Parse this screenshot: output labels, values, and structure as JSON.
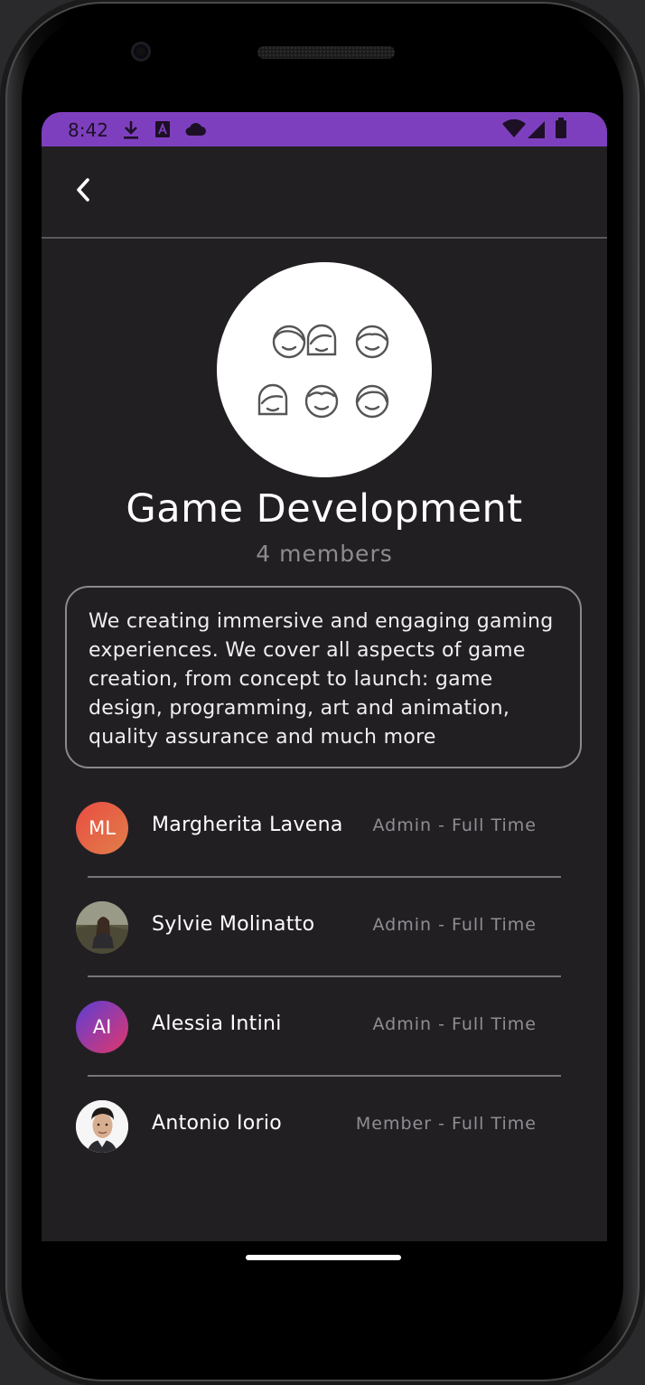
{
  "status_bar": {
    "time": "8:42",
    "left_icons": [
      "download-icon",
      "text-a-icon",
      "cloud-icon"
    ],
    "right_icons": [
      "wifi-icon",
      "signal-icon",
      "battery-icon"
    ],
    "color": "#7e3fbf"
  },
  "header": {
    "back_icon": "chevron-left-icon"
  },
  "group": {
    "avatar_icon": "people-group-icon",
    "title": "Game Development",
    "member_count": "4 members",
    "description": "We creating immersive and engaging gaming experiences. We cover all aspects of game creation, from concept to launch: game design, programming, art and animation, quality assurance and much more"
  },
  "members": [
    {
      "initials": "ML",
      "name": "Margherita Lavena",
      "role": "Admin - Full Time",
      "avatar_type": "initials",
      "avatar_colors": [
        "#e9503f",
        "#e07a4c"
      ]
    },
    {
      "initials": "",
      "name": "Sylvie Molinatto",
      "role": "Admin - Full Time",
      "avatar_type": "photo",
      "avatar_colors": [
        "#6b6a52",
        "#3e3c2e"
      ]
    },
    {
      "initials": "AI",
      "name": "Alessia Intini",
      "role": "Admin - Full Time",
      "avatar_type": "initials",
      "avatar_colors": [
        "#6a3fd1",
        "#d2386b"
      ]
    },
    {
      "initials": "",
      "name": "Antonio Iorio",
      "role": "Member - Full Time",
      "avatar_type": "photo",
      "avatar_colors": [
        "#f4f4f4",
        "#d8b59a"
      ]
    }
  ],
  "colors": {
    "background": "#221f23",
    "accent": "#7e3fbf"
  }
}
